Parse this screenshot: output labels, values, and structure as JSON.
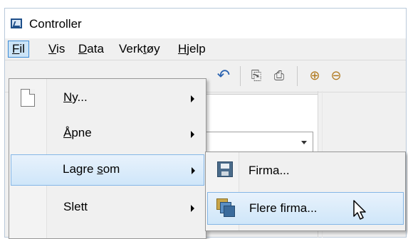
{
  "window": {
    "title": "Controller"
  },
  "menubar": {
    "items": [
      {
        "label": "Fil",
        "underline": "F",
        "rest": "il"
      },
      {
        "label": "Vis",
        "underline": "V",
        "rest": "is"
      },
      {
        "label": "Data",
        "underline": "D",
        "rest": "ata"
      },
      {
        "label": "Verktøy",
        "pre": "Verk",
        "underline": "t",
        "rest": "øy"
      },
      {
        "label": "Hjelp",
        "underline": "H",
        "rest": "jelp"
      }
    ]
  },
  "file_menu": {
    "items": [
      {
        "label": "Ny...",
        "pre": "",
        "underline": "N",
        "rest": "y...",
        "has_submenu": true
      },
      {
        "label": "Åpne",
        "pre": "",
        "underline": "Å",
        "rest": "pne",
        "has_submenu": true
      },
      {
        "label": "Lagre som",
        "pre": "Lagre ",
        "underline": "s",
        "rest": "om",
        "has_submenu": true
      },
      {
        "label": "Slett",
        "pre": "Slett",
        "underline": "",
        "rest": "",
        "has_submenu": true
      }
    ]
  },
  "save_as_submenu": {
    "items": [
      {
        "label": "Firma...",
        "icon": "save-icon"
      },
      {
        "label": "Flere firma...",
        "icon": "multi-company-icon"
      }
    ]
  },
  "colors": {
    "highlight": "#cfe6f9",
    "highlight_border": "#84b6e6",
    "active_menu": "#cce4f7"
  }
}
